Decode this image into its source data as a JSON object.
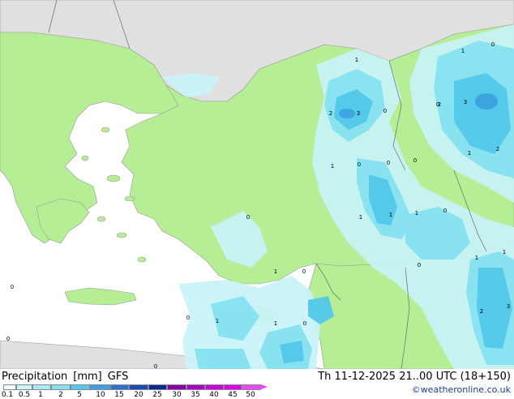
{
  "map": {
    "value_labels": [
      "2",
      "3",
      "0",
      "1",
      "1",
      "0",
      "0",
      "1",
      "1",
      "1",
      "0",
      "0",
      "1",
      "0",
      "0",
      "1",
      "0",
      "1",
      "0",
      "2",
      "3",
      "1",
      "1",
      "3",
      "1",
      "0",
      "1",
      "0",
      "2",
      "2",
      "0",
      "0",
      "0",
      "0"
    ],
    "colors": {
      "land": "#b5ee94",
      "land_outside": "#e0e0e0",
      "sea": "#ffffff",
      "precip_light": "#c8f3f8",
      "precip_mid": "#86e2f0",
      "precip_strong": "#52c8ea",
      "precip_heavy": "#3aa0e0"
    }
  },
  "footer": {
    "title_word1": "Precipitation",
    "title_word2": "[mm]",
    "title_word3": "GFS",
    "datetime": "Th 11-12-2025 21..00 UTC (18+150)",
    "credit": "©weatheronline.co.uk",
    "scale_labels": [
      "0.1",
      "0.5",
      "1",
      "2",
      "5",
      "10",
      "15",
      "20",
      "25",
      "30",
      "35",
      "40",
      "45",
      "50"
    ],
    "scale_colors": [
      "#f3fbff",
      "#c8f3f8",
      "#a6ebf4",
      "#86e2f0",
      "#52c8ea",
      "#3aa0e0",
      "#2a72cc",
      "#1c4ab8",
      "#0c2a8c",
      "#8800aa",
      "#aa00cc",
      "#cc00dd",
      "#dd00ee",
      "#ee44ff"
    ]
  }
}
